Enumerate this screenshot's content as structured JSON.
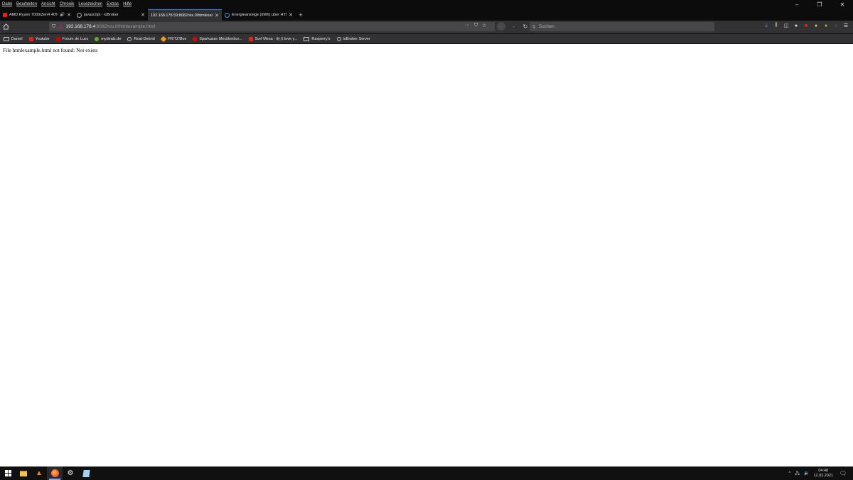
{
  "menu": [
    "Datei",
    "Bearbeiten",
    "Ansicht",
    "Chronik",
    "Lesezeichen",
    "Extras",
    "Hilfe"
  ],
  "window_controls": {
    "minimize": "–",
    "restore": "❐",
    "close": "✕"
  },
  "tabs": [
    {
      "label": "AMD Ryzen 7000/Zen4 40%",
      "favicon": "youtube-icon",
      "audio": "🔊",
      "close": "✕"
    },
    {
      "label": "javascript - ioBroker",
      "favicon": "globe-icon",
      "close": "✕"
    },
    {
      "label": "192.168.178.59:8082/vis.0/htmlexam",
      "favicon": "",
      "close": "✕",
      "active": true
    },
    {
      "label": "Energieanzeige (kWh) über HTM",
      "favicon": "info-icon",
      "close": "✕"
    }
  ],
  "new_tab": "+",
  "urlbar": {
    "host": "192.168.178.4",
    "path": ":8082/vis.0/htmlexample.html"
  },
  "url_actions": {
    "more": "···",
    "pocket": "⛉",
    "star": "☆"
  },
  "nav": {
    "back": "←",
    "forward": "→",
    "reload": "↻"
  },
  "search": {
    "placeholder": "Suchen"
  },
  "toolbar_right": [
    "download-icon",
    "library-icon",
    "sidebar-icon",
    "account-icon",
    "extension-red-icon",
    "extension-yellow-icon",
    "extension-green-icon",
    "extension-circle-icon",
    "menu-icon"
  ],
  "bookmarks": [
    {
      "label": "Daniel",
      "icon": "folder"
    },
    {
      "label": "Youtube",
      "icon": "yt"
    },
    {
      "label": "Forum de Luxx",
      "icon": "red"
    },
    {
      "label": "mydealz.de",
      "icon": "green"
    },
    {
      "label": "Real-Debrid",
      "icon": "circle"
    },
    {
      "label": "FRITZ!Box",
      "icon": "orange"
    },
    {
      "label": "Sparkasse Mecklenbur...",
      "icon": "red"
    },
    {
      "label": "Surf Mesa - ily (i love y...",
      "icon": "yt"
    },
    {
      "label": "Rasperry's",
      "icon": "folder"
    },
    {
      "label": "ioBroker Server",
      "icon": "circle"
    }
  ],
  "content": {
    "message": "File htmlexample.html not found: Not exists"
  },
  "taskbar": {
    "apps": [
      "file-explorer-icon",
      "vlc-icon",
      "firefox-icon",
      "settings-icon",
      "notepad-icon"
    ],
    "tray": {
      "chevron": "^",
      "network": "🖧",
      "volume": "🔉"
    },
    "time": "04:48",
    "date": "12.02.2021",
    "notification": "🗨"
  },
  "colors": {
    "accent": "#0a84ff",
    "toolbar": "#323234",
    "titlebar": "#0c0c0d"
  }
}
